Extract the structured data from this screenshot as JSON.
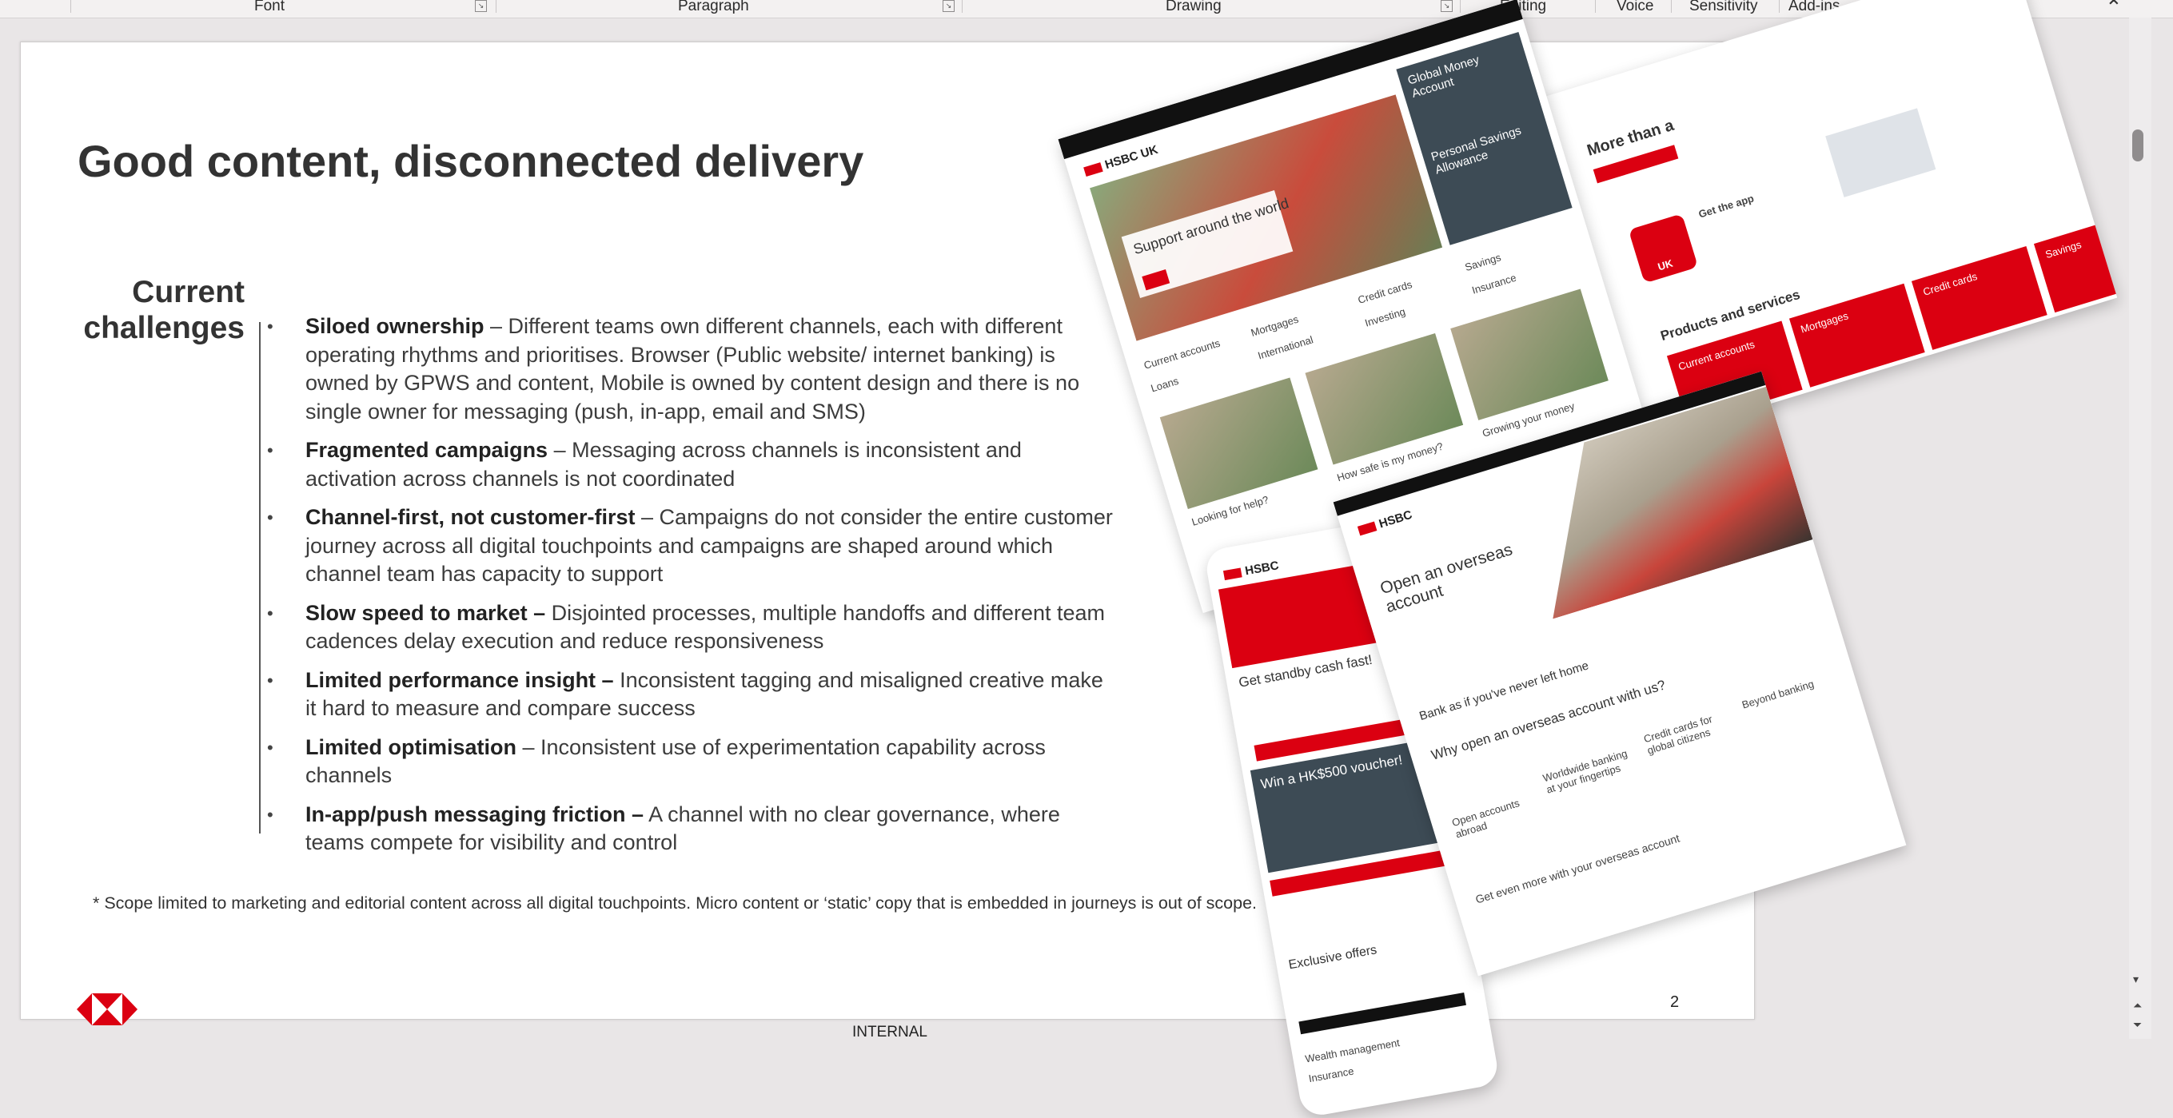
{
  "ribbon": {
    "groups": [
      "Font",
      "Paragraph",
      "Drawing",
      "Editing",
      "Voice",
      "Sensitivity",
      "Add-ins"
    ],
    "collapse_icon": "chevron-up-icon"
  },
  "slide": {
    "title": "Good content, disconnected delivery",
    "section_heading_line1": "Current",
    "section_heading_line2": "challenges",
    "bullets": [
      {
        "bold": "Siloed ownership",
        "text": " – Different teams own different channels, each with different operating rhythms and prioritises. Browser (Public website/ internet banking) is owned by GPWS and content, Mobile is owned by content design and there is no single owner for messaging (push, in-app, email and SMS)"
      },
      {
        "bold": "Fragmented campaigns",
        "text": " – Messaging across channels is inconsistent and activation across channels is not coordinated"
      },
      {
        "bold": "Channel-first, not customer-first",
        "text": " – Campaigns do not consider the entire customer journey across all digital touchpoints and campaigns are shaped around which channel team has capacity to support"
      },
      {
        "bold": "Slow speed to market –",
        "text": " Disjointed processes, multiple handoffs and different team cadences delay execution and reduce responsiveness"
      },
      {
        "bold": "Limited performance insight –",
        "text": " Inconsistent tagging and misaligned creative make it hard to measure and compare success"
      },
      {
        "bold": "Limited optimisation",
        "text": " – Inconsistent use of experimentation capability across channels"
      },
      {
        "bold": "In-app/push messaging friction –",
        "text": " A channel with no clear governance, where teams compete for visibility and control"
      }
    ],
    "footnote": "* Scope limited to marketing and editorial content across all digital touchpoints. Micro content or ‘static’ copy that is embedded in journeys is out of scope.",
    "classification": "INTERNAL",
    "page_number": "2"
  },
  "collage": {
    "site1": {
      "hero_heading": "Support around the world",
      "links": [
        "Current accounts",
        "Mortgages",
        "Credit cards",
        "Savings",
        "International",
        "Investing",
        "Insurance",
        "Loans"
      ],
      "tiles": [
        "Looking for help?",
        "How safe is my money?",
        "Growing your money"
      ],
      "side_heading1": "Global Money Account",
      "side_heading2": "Personal Savings Allowance"
    },
    "site2": {
      "heading": "More than a",
      "products_heading": "Products and services",
      "cards": [
        "Current accounts",
        "Mortgages",
        "Credit cards",
        "Savings"
      ],
      "app_label": "Get the app",
      "uk_badge": "UK"
    },
    "site3": {
      "heading": "Open an overseas account",
      "subheading": "Bank as if you've never left home",
      "why_heading": "Why open an overseas account with us?",
      "features": [
        "Open accounts abroad",
        "Worldwide banking at your fingertips",
        "Credit cards for global citizens",
        "Beyond banking"
      ],
      "even_more": "Get even more with your overseas account"
    },
    "phone": {
      "heading": "Get standby cash fast!",
      "promo": "Win a HK$500 voucher!",
      "offers": "Exclusive offers",
      "menu_items": [
        "Wealth management",
        "Insurance"
      ]
    }
  }
}
